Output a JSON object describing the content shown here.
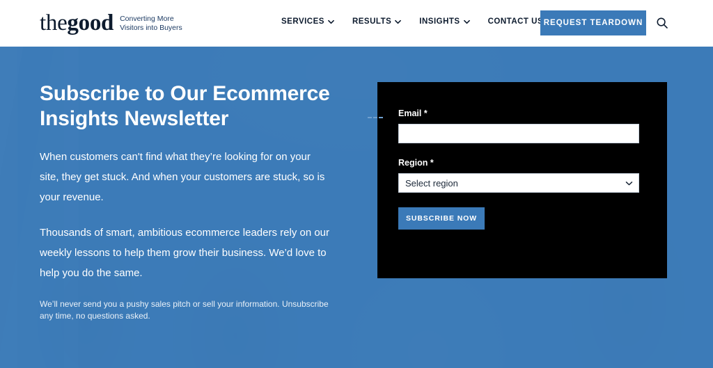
{
  "header": {
    "logo": {
      "the": "the",
      "good": "good",
      "tagline_line1": "Converting More",
      "tagline_line2": "Visitors into Buyers"
    },
    "nav": [
      {
        "label": "SERVICES",
        "has_dropdown": true,
        "icon": "chevron-down-icon"
      },
      {
        "label": "RESULTS",
        "has_dropdown": true,
        "icon": "chevron-down-icon"
      },
      {
        "label": "INSIGHTS",
        "has_dropdown": true,
        "icon": "chevron-down-icon"
      },
      {
        "label": "CONTACT US",
        "has_dropdown": false,
        "icon": ""
      }
    ],
    "cta_label": "REQUEST TEARDOWN",
    "search_icon": "search-icon"
  },
  "hero": {
    "title": "Subscribe to Our Ecommerce Insights Newsletter",
    "paragraph_1": "When customers can't find what they’re looking for on your site, they get stuck. And when your customers are stuck, so is your revenue.",
    "paragraph_2": "Thousands of smart, ambitious ecommerce leaders rely on our weekly lessons to help them grow their business. We’d love to help you do the same.",
    "fine_print": "We’ll never send you a pushy sales pitch or sell your information. Unsubscribe any time, no questions asked."
  },
  "form": {
    "email": {
      "label": "Email *",
      "value": "",
      "placeholder": ""
    },
    "region": {
      "label": "Region *",
      "selected": "Select region",
      "chevron_icon": "chevron-down-icon"
    },
    "submit_label": "SUBSCRIBE NOW"
  },
  "colors": {
    "brand_blue": "#3b7ab8",
    "navy_text": "#0d1b2e",
    "panel_black": "#000000",
    "white": "#ffffff"
  }
}
